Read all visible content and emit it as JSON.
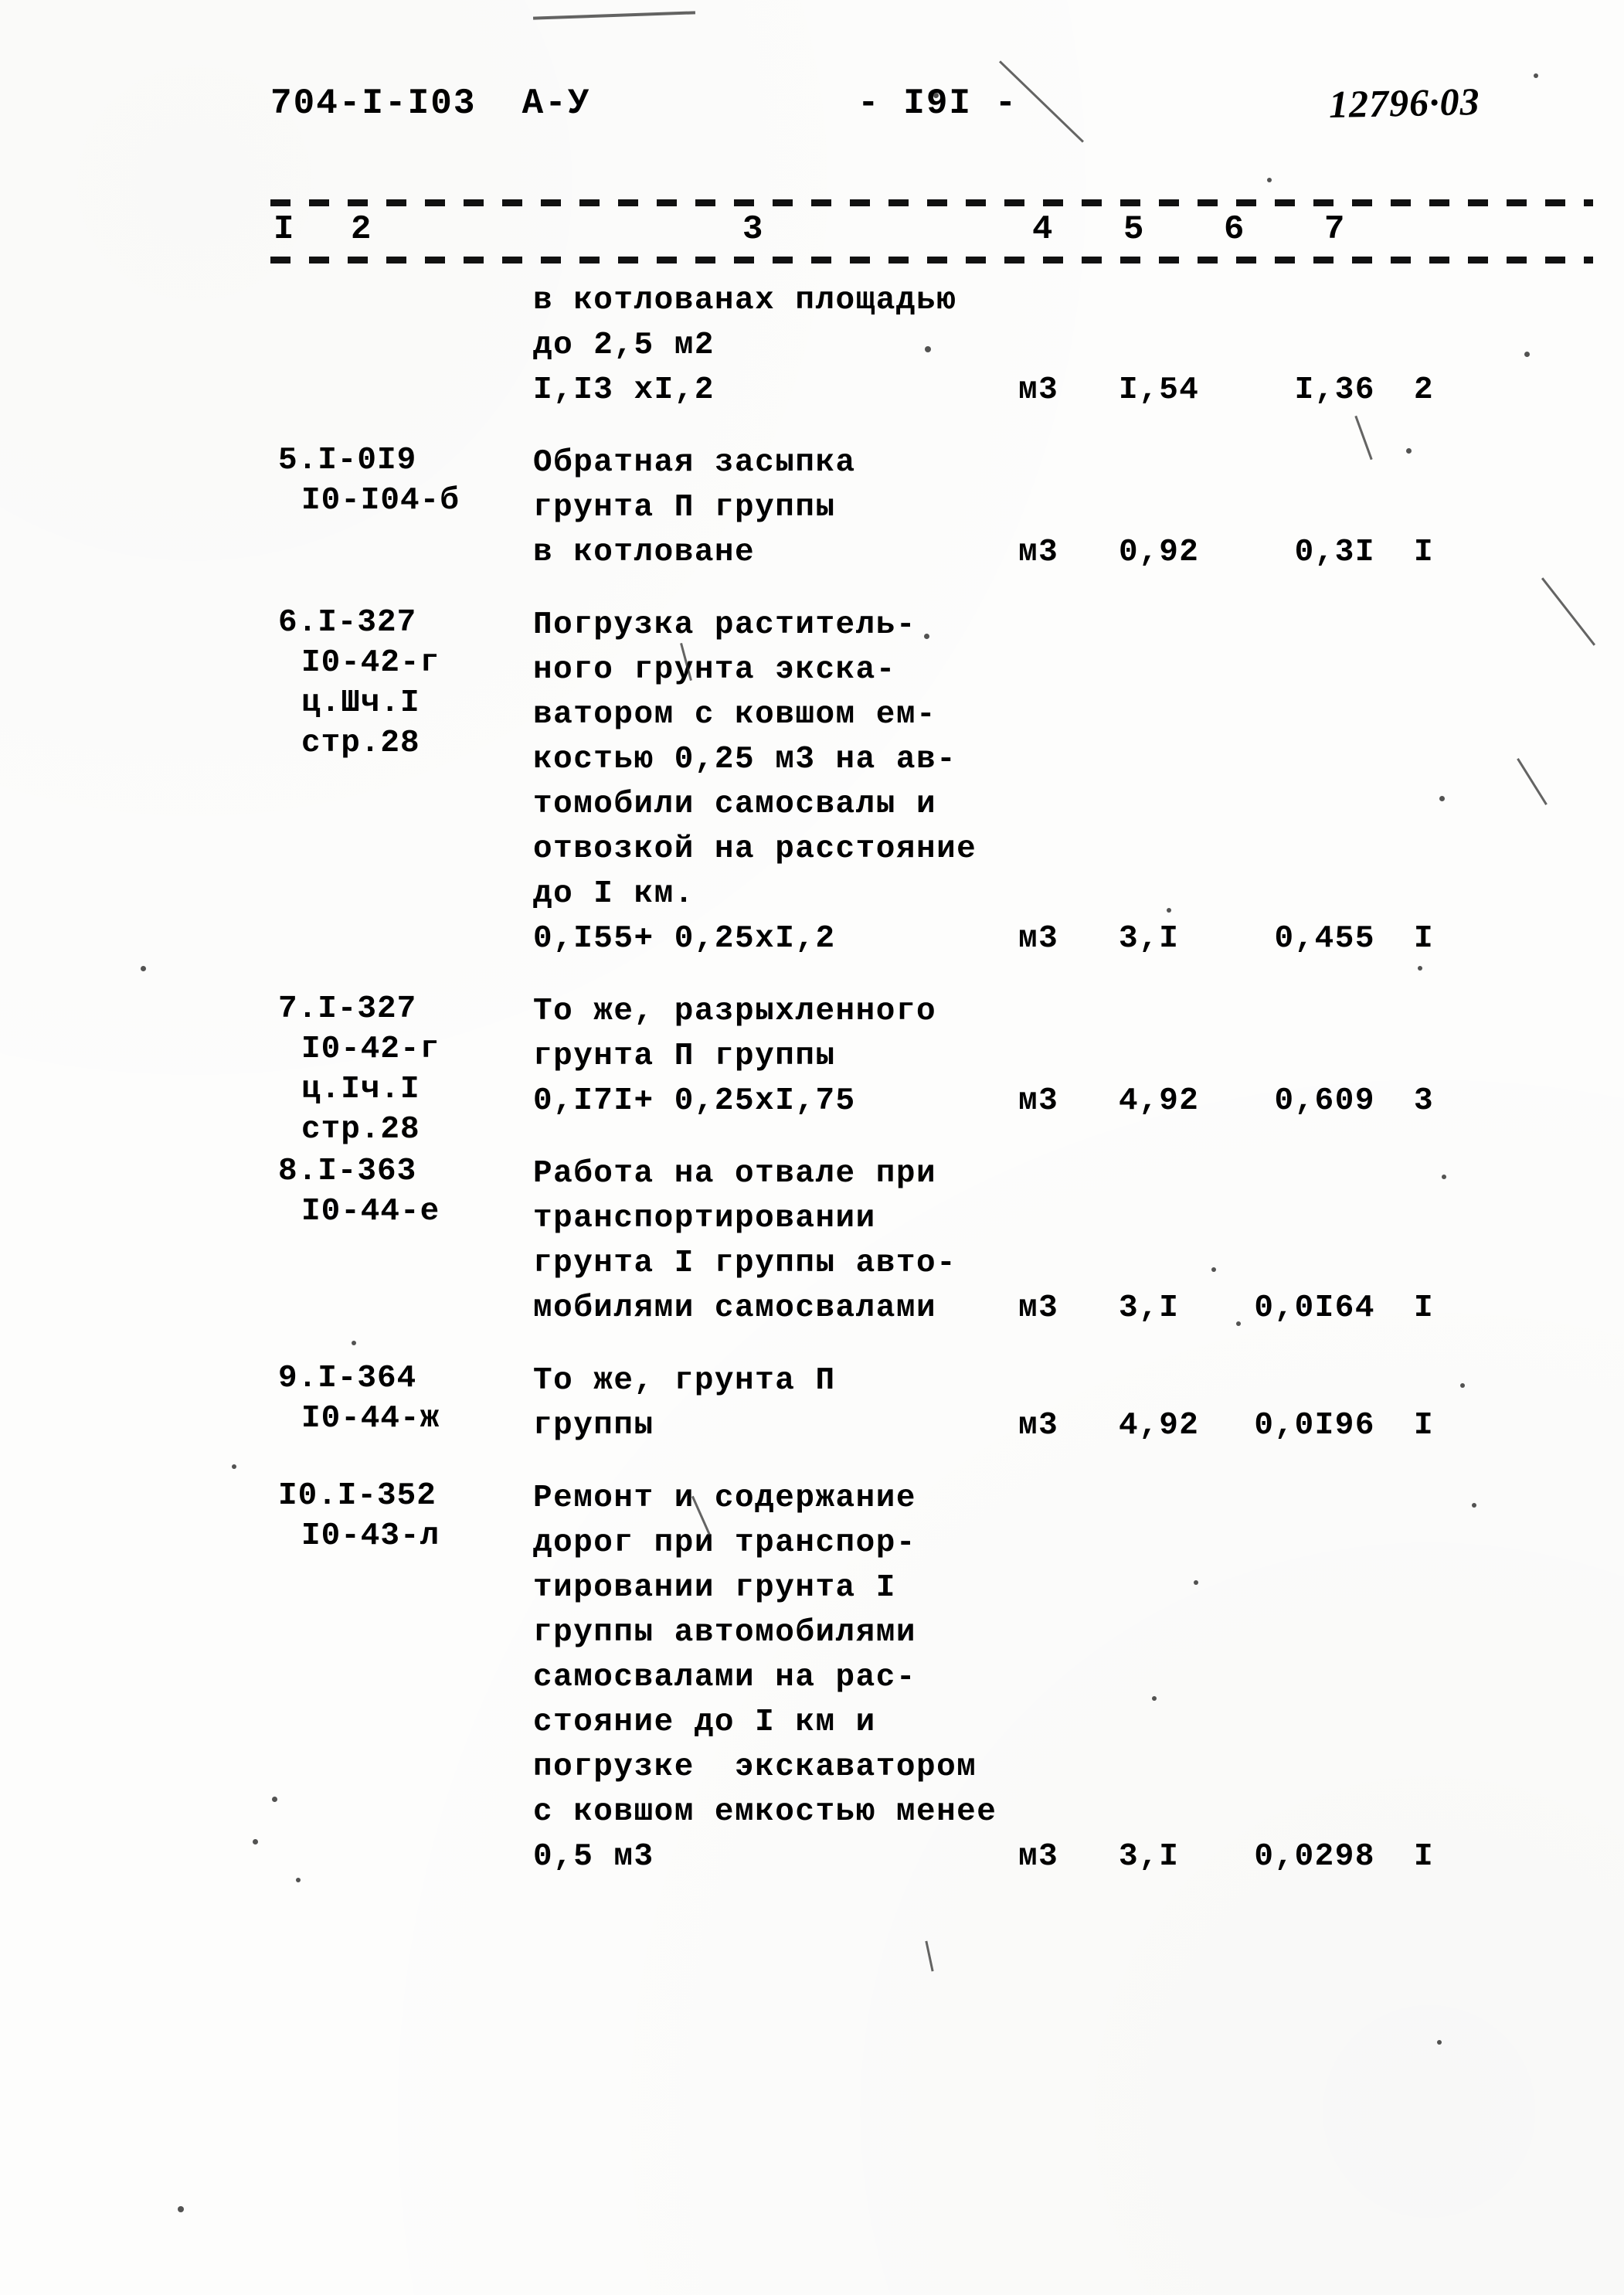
{
  "header": {
    "doc_code": "704-I-I03  А-У",
    "page_number": "- I9I -",
    "stamp": "12796·03"
  },
  "table": {
    "column_headers": [
      "I",
      "2",
      "3",
      "4",
      "5",
      "6",
      "7"
    ],
    "rows": [
      {
        "codes": [
          "",
          ""
        ],
        "desc": [
          "в котлованах площадью",
          "до 2,5 м2",
          "I,I3 xI,2"
        ],
        "unit": "м3",
        "col5": "I,54",
        "col6": "I,36",
        "col7": "2",
        "value_line": 2
      },
      {
        "codes": [
          "5.I-0I9",
          "I0-I04-б"
        ],
        "desc": [
          "Обратная засыпка",
          "грунта П группы",
          "в котловане"
        ],
        "unit": "м3",
        "col5": "0,92",
        "col6": "0,3I",
        "col7": "I",
        "value_line": 2
      },
      {
        "codes": [
          "6.I-327",
          "I0-42-г",
          "ц.Шч.I",
          "стр.28"
        ],
        "desc": [
          "Погрузка раститель-",
          "ного грунта экска-",
          "ватором с ковшом ем-",
          "костью 0,25 м3 на ав-",
          "томобили самосвалы и",
          "отвозкой на расстояние",
          "до I км.",
          "0,I55+ 0,25xI,2"
        ],
        "unit": "м3",
        "col5": "3,I",
        "col6": "0,455",
        "col7": "I",
        "value_line": 7
      },
      {
        "codes": [
          "7.I-327",
          "I0-42-г",
          "ц.Iч.I",
          "стр.28"
        ],
        "desc": [
          "То же, разрыхленного",
          "грунта П группы",
          "0,I7I+ 0,25xI,75"
        ],
        "unit": "м3",
        "col5": "4,92",
        "col6": "0,609",
        "col7": "3",
        "value_line": 2
      },
      {
        "codes": [
          "8.I-363",
          "I0-44-е"
        ],
        "desc": [
          "Работа на отвале при",
          "транспортировании",
          "грунта I группы авто-",
          "мобилями самосвалами"
        ],
        "unit": "м3",
        "col5": "3,I",
        "col6": "0,0I64",
        "col7": "I",
        "value_line": 3
      },
      {
        "codes": [
          "9.I-364",
          "I0-44-ж"
        ],
        "desc": [
          "То же, грунта П",
          "группы"
        ],
        "unit": "м3",
        "col5": "4,92",
        "col6": "0,0I96",
        "col7": "I",
        "value_line": 1
      },
      {
        "codes": [
          "I0.I-352",
          "I0-43-л"
        ],
        "desc": [
          "Ремонт и содержание",
          "дорог при транспор-",
          "тировании грунта I",
          "группы автомобилями",
          "самосвалами на рас-",
          "стояние до I км и",
          "погрузке  экскаватором",
          "с ковшом емкостью менее",
          "0,5 м3"
        ],
        "unit": "м3",
        "col5": "3,I",
        "col6": "0,0298",
        "col7": "I",
        "value_line": 8
      }
    ]
  }
}
